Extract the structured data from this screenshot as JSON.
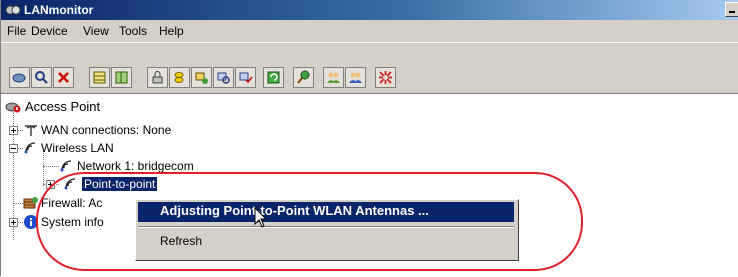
{
  "window": {
    "title": "LANmonitor"
  },
  "menu": [
    "File",
    "Device",
    "View",
    "Tools",
    "Help"
  ],
  "toolbar": {
    "icons": [
      "open-icon",
      "search-device-icon",
      "delete-icon",
      "grid-icon",
      "grid-alt-icon",
      "lock-icon",
      "coins-icon",
      "network-add-icon",
      "network-search-icon",
      "network-check-icon",
      "refresh-green-icon",
      "pin-icon",
      "group-icon",
      "group-alt-icon",
      "disconnect-icon"
    ]
  },
  "tree": {
    "root": "Access Point",
    "wan": "WAN connections: None",
    "wlan": "Wireless LAN",
    "network1": "Network 1: bridgecom",
    "p2p": "Point-to-point",
    "firewall": "Firewall: Ac",
    "sysinfo": "System info"
  },
  "context_menu": {
    "item_adjust": "Adjusting Point-to-Point WLAN Antennas ...",
    "item_refresh": "Refresh"
  },
  "colors": {
    "titlebar": "#0a246a",
    "highlight": "#0a246a",
    "annotation": "#e0232a",
    "chrome": "#d4d0c8"
  }
}
